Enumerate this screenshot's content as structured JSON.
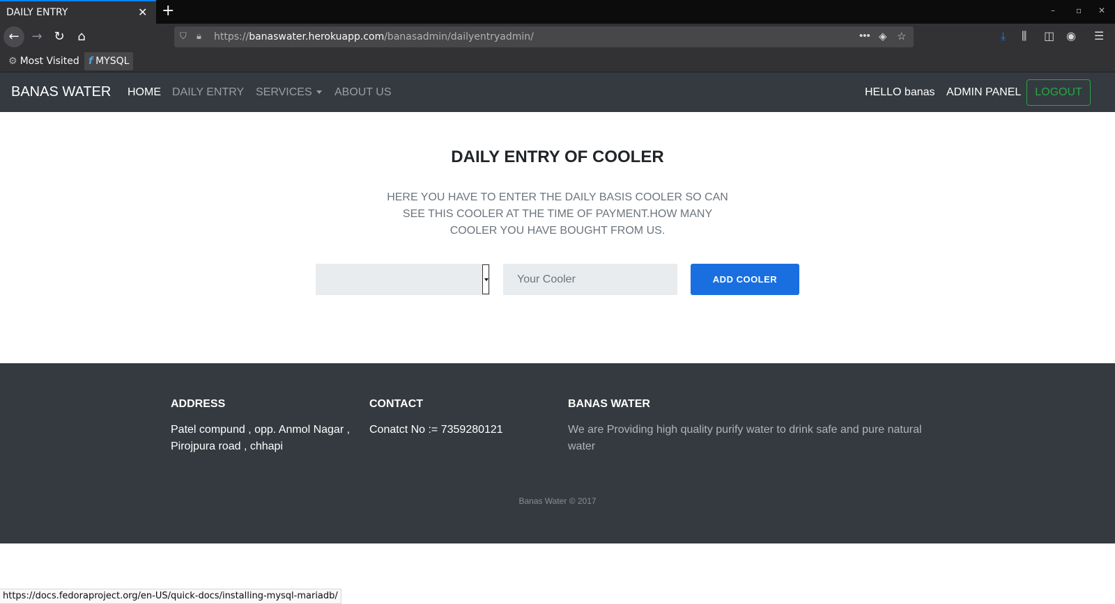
{
  "browser": {
    "tab_title": "DAILY ENTRY",
    "tab_close": "✕",
    "new_tab": "+",
    "window_controls": [
      "–",
      "▫",
      "✕"
    ],
    "url_scheme": "https://",
    "url_host": "banaswater.herokuapp.com",
    "url_path": "/banasadmin/dailyentryadmin/",
    "bookmarks": [
      {
        "icon": "gear-icon",
        "label": "Most Visited"
      },
      {
        "icon": "fedora-icon",
        "label": "MYSQL"
      }
    ],
    "status_url": "https://docs.fedoraproject.org/en-US/quick-docs/installing-mysql-mariadb/"
  },
  "site_nav": {
    "brand": "BANAS WATER",
    "links": [
      "HOME",
      "DAILY ENTRY",
      "SERVICES",
      "ABOUT US"
    ],
    "greeting": "HELLO banas",
    "admin": "ADMIN PANEL",
    "logout": "LOGOUT"
  },
  "main": {
    "title": "DAILY ENTRY OF COOLER",
    "description": "HERE YOU HAVE TO ENTER THE DAILY BASIS COOLER SO CAN SEE THIS COOLER AT THE TIME OF PAYMENT.HOW MANY COOLER YOU HAVE BOUGHT FROM US.",
    "select_value": "",
    "cooler_placeholder": "Your Cooler",
    "add_button": "ADD COOLER"
  },
  "footer": {
    "address_head": "ADDRESS",
    "address_text": "Patel compund , opp. Anmol Nagar , Pirojpura road , chhapi",
    "contact_head": "CONTACT",
    "contact_text": "Conatct No := 7359280121",
    "about_head": "BANAS WATER",
    "about_text": "We are Providing high quality purify water to drink safe and pure natural water",
    "copyright": "Banas Water © 2017"
  },
  "colors": {
    "nav_bg": "#343a40",
    "button_primary": "#1a6fe0",
    "logout_green": "#28a745"
  }
}
